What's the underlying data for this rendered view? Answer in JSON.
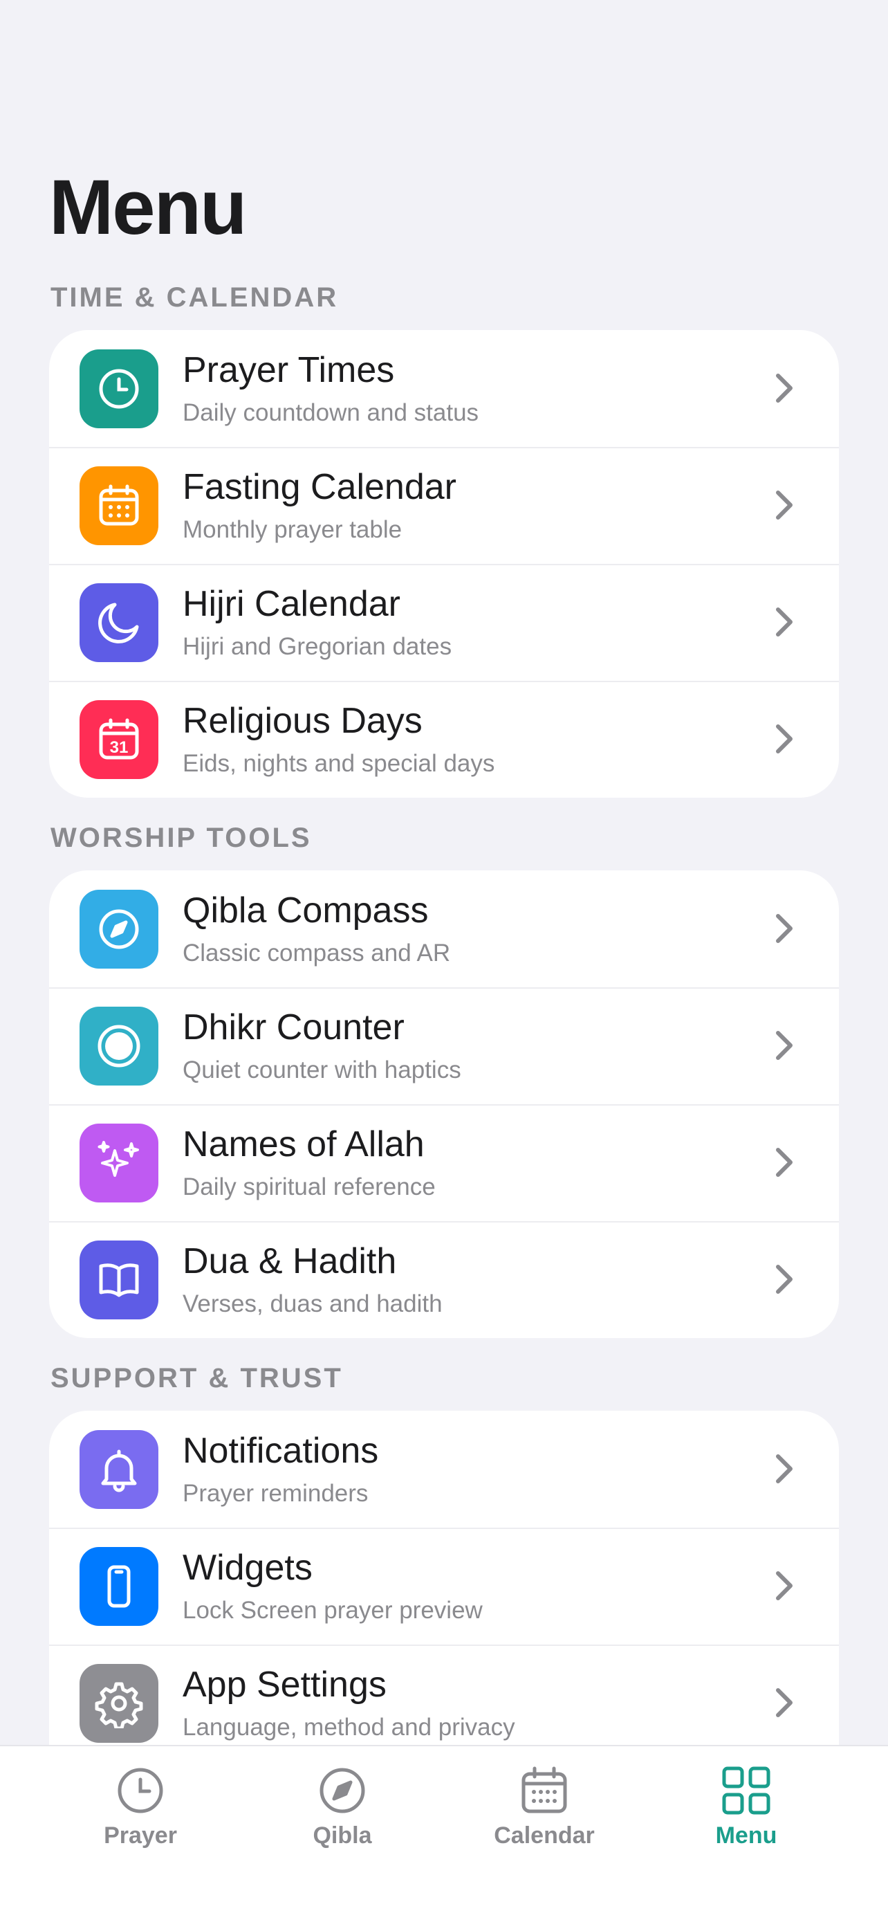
{
  "page_title": "Menu",
  "colors": {
    "accent": "#1a9e8c",
    "background": "#f2f2f7",
    "card": "#ffffff",
    "secondary_text": "#8a8a8e"
  },
  "sections": [
    {
      "header": "TIME & CALENDAR",
      "items": [
        {
          "title": "Prayer Times",
          "subtitle": "Daily countdown and status",
          "icon": "clock-icon",
          "color": "#1a9e8c"
        },
        {
          "title": "Fasting Calendar",
          "subtitle": "Monthly prayer table",
          "icon": "calendar-grid-icon",
          "color": "#ff9500"
        },
        {
          "title": "Hijri Calendar",
          "subtitle": "Hijri and Gregorian dates",
          "icon": "moon-icon",
          "color": "#5e5ce6"
        },
        {
          "title": "Religious Days",
          "subtitle": "Eids, nights and special days",
          "icon": "calendar-31-icon",
          "color": "#ff2d55"
        }
      ]
    },
    {
      "header": "WORSHIP TOOLS",
      "items": [
        {
          "title": "Qibla Compass",
          "subtitle": "Classic compass and AR",
          "icon": "compass-icon",
          "color": "#32ade6"
        },
        {
          "title": "Dhikr Counter",
          "subtitle": "Quiet counter with haptics",
          "icon": "circle-icon",
          "color": "#30b0c7"
        },
        {
          "title": "Names of Allah",
          "subtitle": "Daily spiritual reference",
          "icon": "sparkles-icon",
          "color": "#bf5af2"
        },
        {
          "title": "Dua & Hadith",
          "subtitle": "Verses, duas and hadith",
          "icon": "book-icon",
          "color": "#5e5ce6"
        }
      ]
    },
    {
      "header": "SUPPORT & TRUST",
      "items": [
        {
          "title": "Notifications",
          "subtitle": "Prayer reminders",
          "icon": "bell-icon",
          "color": "#7a6cf0"
        },
        {
          "title": "Widgets",
          "subtitle": "Lock Screen prayer preview",
          "icon": "phone-icon",
          "color": "#007aff"
        },
        {
          "title": "App Settings",
          "subtitle": "Language, method and privacy",
          "icon": "gear-icon",
          "color": "#8e8e93"
        }
      ]
    }
  ],
  "tab_bar": {
    "tabs": [
      {
        "label": "Prayer",
        "icon": "clock-icon",
        "active": false
      },
      {
        "label": "Qibla",
        "icon": "compass-icon",
        "active": false
      },
      {
        "label": "Calendar",
        "icon": "calendar-icon",
        "active": false
      },
      {
        "label": "Menu",
        "icon": "grid-icon",
        "active": true
      }
    ]
  }
}
